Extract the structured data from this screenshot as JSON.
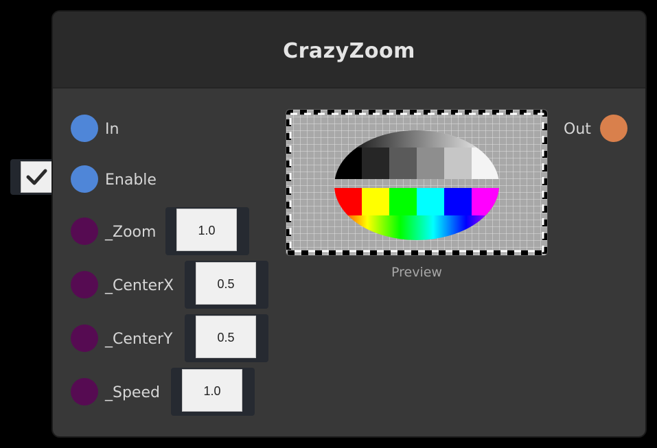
{
  "node": {
    "title": "CrazyZoom"
  },
  "inputs": {
    "in_label": "In",
    "enable_label": "Enable",
    "zoom": {
      "label": "_Zoom",
      "value": "1.0"
    },
    "centerx": {
      "label": "_CenterX",
      "value": "0.5"
    },
    "centery": {
      "label": "_CenterY",
      "value": "0.5"
    },
    "speed": {
      "label": "_Speed",
      "value": "1.0"
    }
  },
  "outputs": {
    "out_label": "Out"
  },
  "preview": {
    "label": "Preview"
  },
  "enable_checked": true,
  "colors": {
    "background": "#000000",
    "node_body": "#383838",
    "node_header": "#2a2a2a",
    "port_image": "#4f86d8",
    "port_float": "#560b52",
    "port_output": "#d9804c",
    "text": "#d6d6d6"
  },
  "icons": {
    "checkbox": "check-icon"
  }
}
